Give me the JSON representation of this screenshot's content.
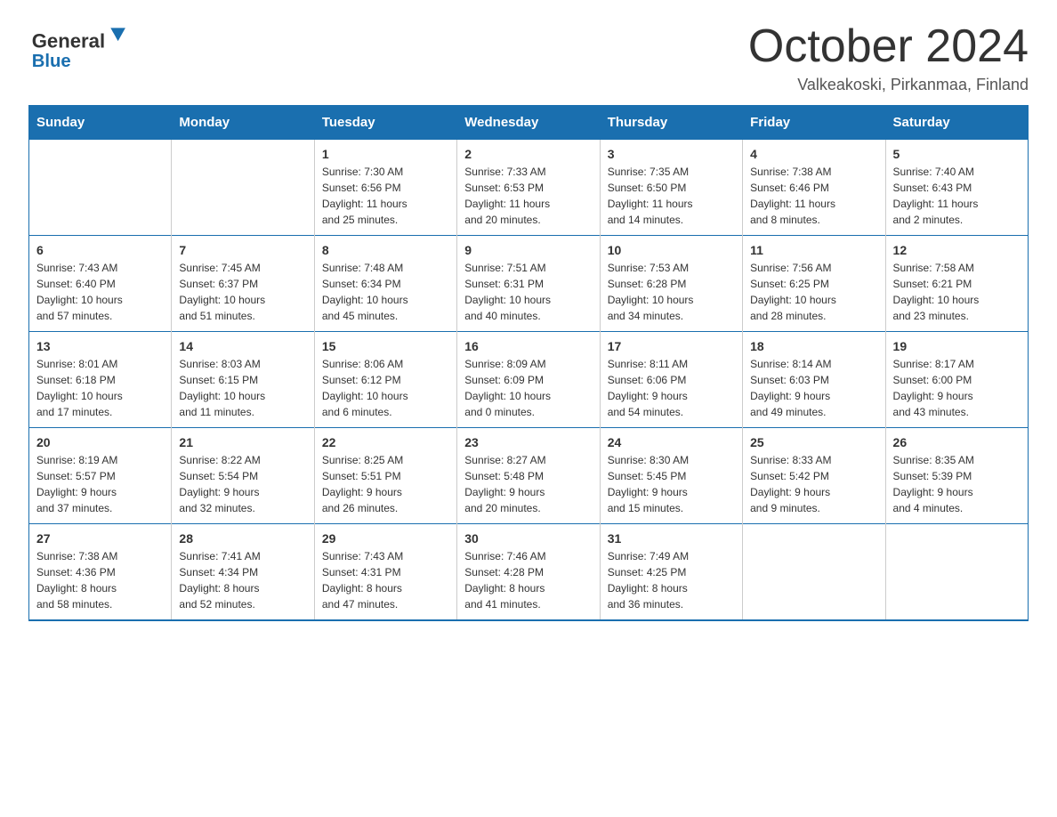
{
  "header": {
    "logo": {
      "general": "General",
      "triangle_symbol": "▶",
      "blue": "Blue"
    },
    "title": "October 2024",
    "location": "Valkeakoski, Pirkanmaa, Finland"
  },
  "weekdays": [
    "Sunday",
    "Monday",
    "Tuesday",
    "Wednesday",
    "Thursday",
    "Friday",
    "Saturday"
  ],
  "weeks": [
    [
      {
        "day": "",
        "info": ""
      },
      {
        "day": "",
        "info": ""
      },
      {
        "day": "1",
        "info": "Sunrise: 7:30 AM\nSunset: 6:56 PM\nDaylight: 11 hours\nand 25 minutes."
      },
      {
        "day": "2",
        "info": "Sunrise: 7:33 AM\nSunset: 6:53 PM\nDaylight: 11 hours\nand 20 minutes."
      },
      {
        "day": "3",
        "info": "Sunrise: 7:35 AM\nSunset: 6:50 PM\nDaylight: 11 hours\nand 14 minutes."
      },
      {
        "day": "4",
        "info": "Sunrise: 7:38 AM\nSunset: 6:46 PM\nDaylight: 11 hours\nand 8 minutes."
      },
      {
        "day": "5",
        "info": "Sunrise: 7:40 AM\nSunset: 6:43 PM\nDaylight: 11 hours\nand 2 minutes."
      }
    ],
    [
      {
        "day": "6",
        "info": "Sunrise: 7:43 AM\nSunset: 6:40 PM\nDaylight: 10 hours\nand 57 minutes."
      },
      {
        "day": "7",
        "info": "Sunrise: 7:45 AM\nSunset: 6:37 PM\nDaylight: 10 hours\nand 51 minutes."
      },
      {
        "day": "8",
        "info": "Sunrise: 7:48 AM\nSunset: 6:34 PM\nDaylight: 10 hours\nand 45 minutes."
      },
      {
        "day": "9",
        "info": "Sunrise: 7:51 AM\nSunset: 6:31 PM\nDaylight: 10 hours\nand 40 minutes."
      },
      {
        "day": "10",
        "info": "Sunrise: 7:53 AM\nSunset: 6:28 PM\nDaylight: 10 hours\nand 34 minutes."
      },
      {
        "day": "11",
        "info": "Sunrise: 7:56 AM\nSunset: 6:25 PM\nDaylight: 10 hours\nand 28 minutes."
      },
      {
        "day": "12",
        "info": "Sunrise: 7:58 AM\nSunset: 6:21 PM\nDaylight: 10 hours\nand 23 minutes."
      }
    ],
    [
      {
        "day": "13",
        "info": "Sunrise: 8:01 AM\nSunset: 6:18 PM\nDaylight: 10 hours\nand 17 minutes."
      },
      {
        "day": "14",
        "info": "Sunrise: 8:03 AM\nSunset: 6:15 PM\nDaylight: 10 hours\nand 11 minutes."
      },
      {
        "day": "15",
        "info": "Sunrise: 8:06 AM\nSunset: 6:12 PM\nDaylight: 10 hours\nand 6 minutes."
      },
      {
        "day": "16",
        "info": "Sunrise: 8:09 AM\nSunset: 6:09 PM\nDaylight: 10 hours\nand 0 minutes."
      },
      {
        "day": "17",
        "info": "Sunrise: 8:11 AM\nSunset: 6:06 PM\nDaylight: 9 hours\nand 54 minutes."
      },
      {
        "day": "18",
        "info": "Sunrise: 8:14 AM\nSunset: 6:03 PM\nDaylight: 9 hours\nand 49 minutes."
      },
      {
        "day": "19",
        "info": "Sunrise: 8:17 AM\nSunset: 6:00 PM\nDaylight: 9 hours\nand 43 minutes."
      }
    ],
    [
      {
        "day": "20",
        "info": "Sunrise: 8:19 AM\nSunset: 5:57 PM\nDaylight: 9 hours\nand 37 minutes."
      },
      {
        "day": "21",
        "info": "Sunrise: 8:22 AM\nSunset: 5:54 PM\nDaylight: 9 hours\nand 32 minutes."
      },
      {
        "day": "22",
        "info": "Sunrise: 8:25 AM\nSunset: 5:51 PM\nDaylight: 9 hours\nand 26 minutes."
      },
      {
        "day": "23",
        "info": "Sunrise: 8:27 AM\nSunset: 5:48 PM\nDaylight: 9 hours\nand 20 minutes."
      },
      {
        "day": "24",
        "info": "Sunrise: 8:30 AM\nSunset: 5:45 PM\nDaylight: 9 hours\nand 15 minutes."
      },
      {
        "day": "25",
        "info": "Sunrise: 8:33 AM\nSunset: 5:42 PM\nDaylight: 9 hours\nand 9 minutes."
      },
      {
        "day": "26",
        "info": "Sunrise: 8:35 AM\nSunset: 5:39 PM\nDaylight: 9 hours\nand 4 minutes."
      }
    ],
    [
      {
        "day": "27",
        "info": "Sunrise: 7:38 AM\nSunset: 4:36 PM\nDaylight: 8 hours\nand 58 minutes."
      },
      {
        "day": "28",
        "info": "Sunrise: 7:41 AM\nSunset: 4:34 PM\nDaylight: 8 hours\nand 52 minutes."
      },
      {
        "day": "29",
        "info": "Sunrise: 7:43 AM\nSunset: 4:31 PM\nDaylight: 8 hours\nand 47 minutes."
      },
      {
        "day": "30",
        "info": "Sunrise: 7:46 AM\nSunset: 4:28 PM\nDaylight: 8 hours\nand 41 minutes."
      },
      {
        "day": "31",
        "info": "Sunrise: 7:49 AM\nSunset: 4:25 PM\nDaylight: 8 hours\nand 36 minutes."
      },
      {
        "day": "",
        "info": ""
      },
      {
        "day": "",
        "info": ""
      }
    ]
  ]
}
